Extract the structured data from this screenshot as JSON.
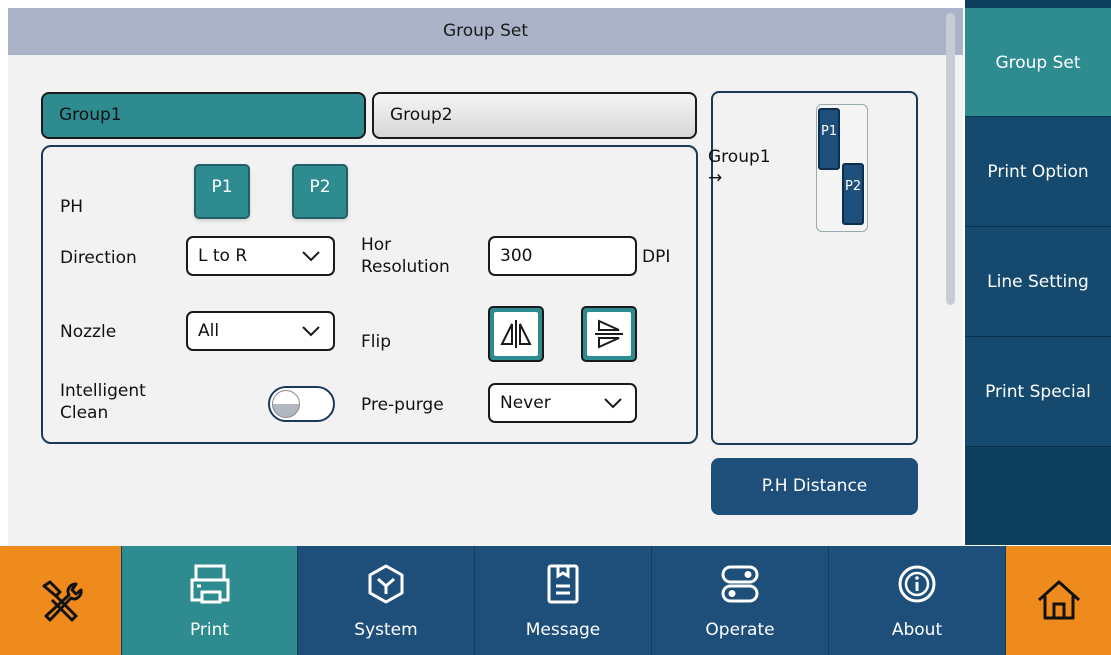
{
  "title": "Group Set",
  "tabs": {
    "group1": "Group1",
    "group2": "Group2"
  },
  "settings": {
    "ph_label": "PH",
    "ph_buttons": [
      "P1",
      "P2"
    ],
    "direction_label": "Direction",
    "direction_value": "L to R",
    "hor_resolution_label_1": "Hor",
    "hor_resolution_label_2": "Resolution",
    "hor_resolution_value": "300",
    "hor_resolution_unit": "DPI",
    "nozzle_label": "Nozzle",
    "nozzle_value": "All",
    "flip_label": "Flip",
    "intelligent_clean_label_1": "Intelligent",
    "intelligent_clean_label_2": "Clean",
    "intelligent_clean_on": false,
    "pre_purge_label": "Pre-purge",
    "pre_purge_value": "Never"
  },
  "preview": {
    "label": "Group1",
    "arrow": "→",
    "heads": [
      "P1",
      "P2"
    ]
  },
  "ph_distance_button": "P.H Distance",
  "side_menu": [
    "Group Set",
    "Print Option",
    "Line Setting",
    "Print Special"
  ],
  "bottom_nav": {
    "print": "Print",
    "system": "System",
    "message": "Message",
    "operate": "Operate",
    "about": "About"
  },
  "colors": {
    "accent_teal": "#2e8c91",
    "navy": "#1d4f7a",
    "orange": "#ef8a1d"
  },
  "icons": {
    "tools": "tools-icon",
    "print": "printer-icon",
    "system": "cube-icon",
    "message": "document-icon",
    "operate": "toggles-icon",
    "about": "info-icon",
    "home": "home-icon"
  }
}
